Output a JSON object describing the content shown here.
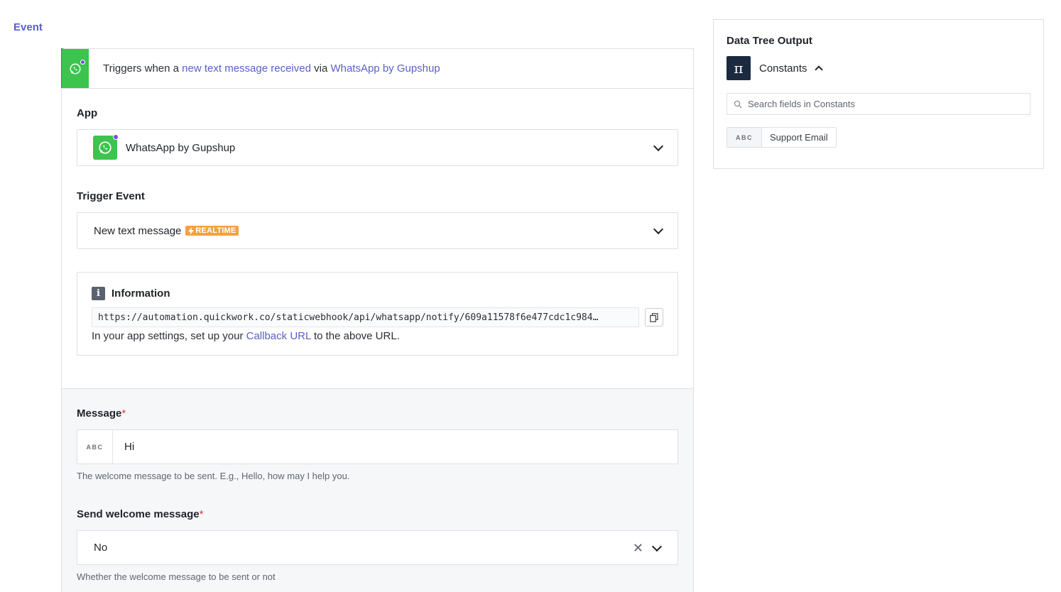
{
  "nav": {
    "event_label": "Event"
  },
  "trigger": {
    "prefix": "Triggers when a ",
    "event_link": "new text message received",
    "via": " via ",
    "app_link": "WhatsApp by Gupshup"
  },
  "app_field": {
    "label": "App",
    "value": "WhatsApp by Gupshup"
  },
  "trigger_event": {
    "label": "Trigger Event",
    "value": "New text message",
    "badge": "REALTIME"
  },
  "information": {
    "title": "Information",
    "url": "https://automation.quickwork.co/staticwebhook/api/whatsapp/notify/609a11578f6e477cdc1c984…",
    "note_prefix": "In your app settings, set up your ",
    "note_link": "Callback URL",
    "note_suffix": " to the above URL."
  },
  "message": {
    "label": "Message",
    "required": "*",
    "type_tag": "ABC",
    "value": "Hi",
    "hint": "The welcome message to be sent. E.g., Hello, how may I help you."
  },
  "send_welcome": {
    "label": "Send welcome message",
    "required": "*",
    "value": "No",
    "hint": "Whether the welcome message to be sent or not"
  },
  "data_tree": {
    "title": "Data Tree Output",
    "group_label": "Constants",
    "search_placeholder": "Search fields in Constants",
    "fields": [
      {
        "type_tag": "ABC",
        "name": "Support Email"
      }
    ]
  },
  "colors": {
    "accent": "#5b5fc7",
    "whatsapp_green": "#3cc44e",
    "realtime_orange": "#f4a240",
    "required_red": "#d93b3b"
  }
}
